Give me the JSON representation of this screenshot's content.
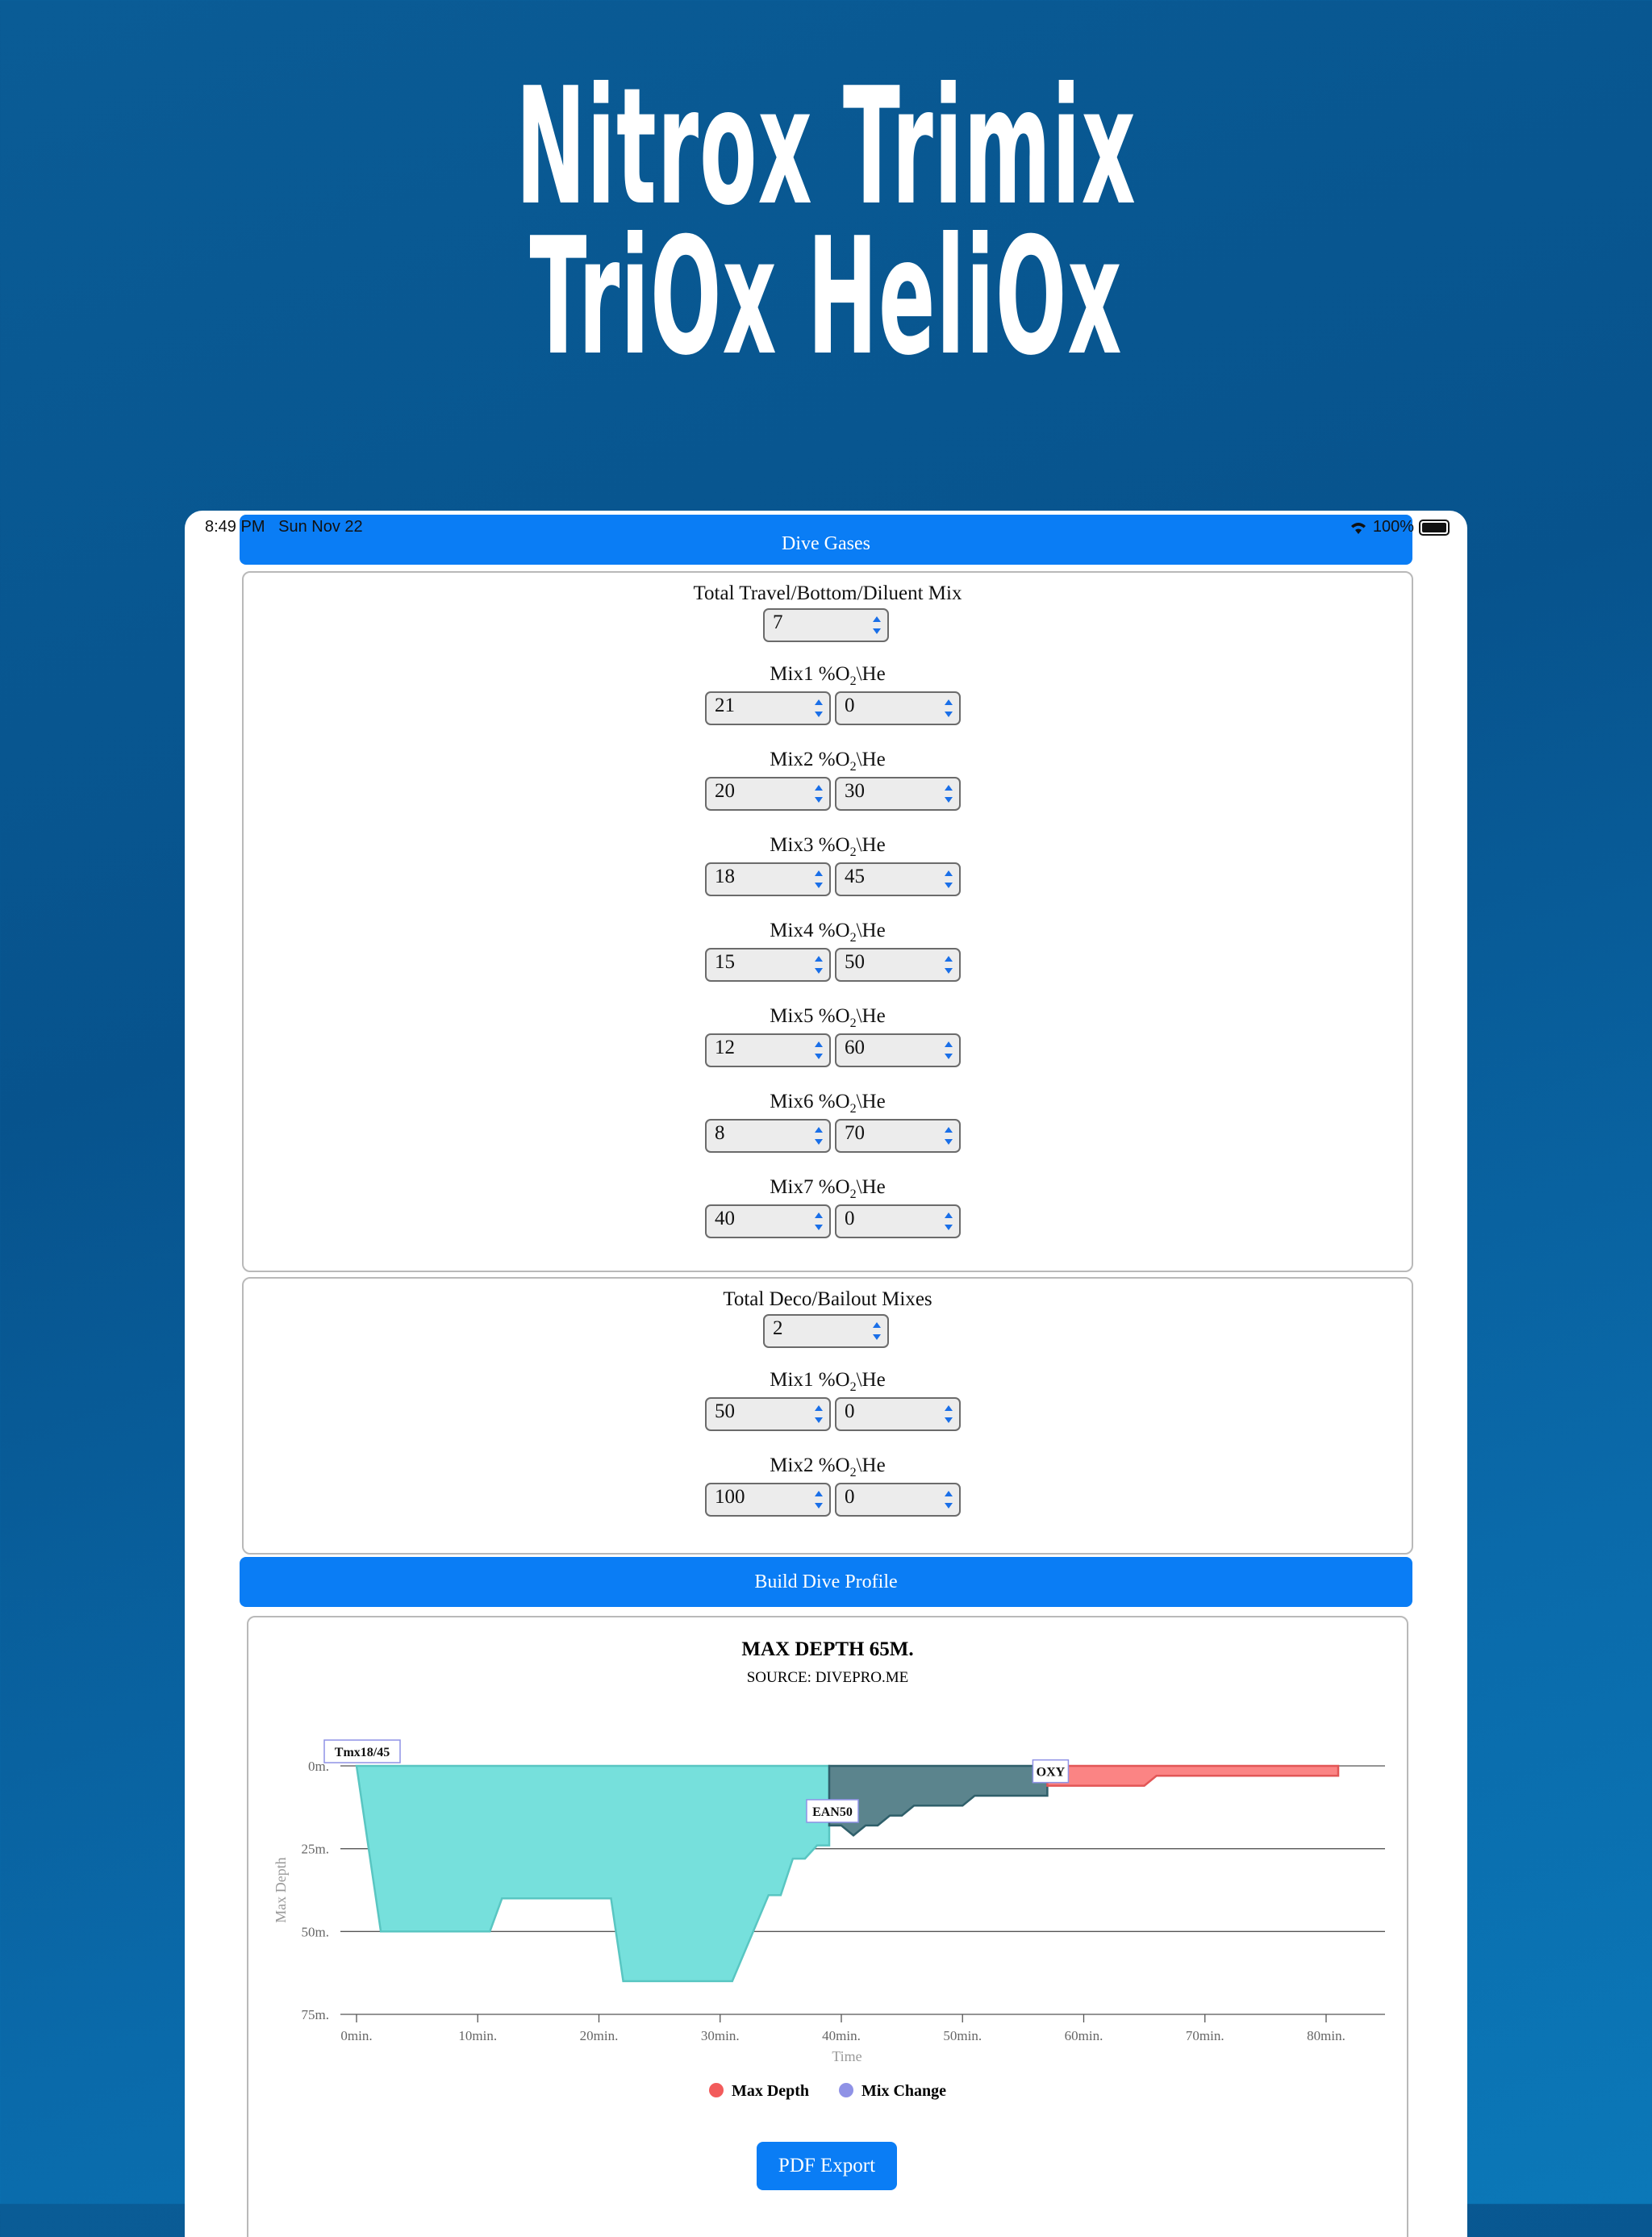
{
  "hero": {
    "line1": "Nitrox Trimix",
    "line2": "TriOx HeliOx"
  },
  "status_bar": {
    "time": "8:49 PM",
    "date": "Sun Nov 22",
    "battery": "100%",
    "wifi_icon": "wifi-icon",
    "battery_icon": "battery-icon"
  },
  "dive_gases_header": "Dive Gases",
  "travel": {
    "total_label": "Total Travel/Bottom/Diluent Mix",
    "total_value": "7",
    "mixes": [
      {
        "label": "Mix1 %O",
        "o2": "21",
        "he": "0"
      },
      {
        "label": "Mix2 %O",
        "o2": "20",
        "he": "30"
      },
      {
        "label": "Mix3 %O",
        "o2": "18",
        "he": "45"
      },
      {
        "label": "Mix4 %O",
        "o2": "15",
        "he": "50"
      },
      {
        "label": "Mix5 %O",
        "o2": "12",
        "he": "60"
      },
      {
        "label": "Mix6 %O",
        "o2": "8",
        "he": "70"
      },
      {
        "label": "Mix7 %O",
        "o2": "40",
        "he": "0"
      }
    ]
  },
  "deco": {
    "total_label": "Total Deco/Bailout Mixes",
    "total_value": "2",
    "mixes": [
      {
        "label": "Mix1 %O",
        "o2": "50",
        "he": "0"
      },
      {
        "label": "Mix2 %O",
        "o2": "100",
        "he": "0"
      }
    ]
  },
  "o2_subscript": "2",
  "he_suffix": "\\He",
  "build_button": "Build Dive Profile",
  "pdf_button": "PDF Export",
  "chart_data": {
    "type": "area",
    "title": "MAX DEPTH 65M.",
    "subtitle": "SOURCE: DIVEPRO.ME",
    "xlabel": "Time",
    "ylabel": "Max Depth",
    "xlim": [
      0,
      80
    ],
    "ylim": [
      0,
      75
    ],
    "x_ticks": [
      "0min.",
      "10min.",
      "20min.",
      "30min.",
      "40min.",
      "50min.",
      "60min.",
      "70min.",
      "80min."
    ],
    "y_ticks": [
      "0m.",
      "25m.",
      "50m.",
      "75m."
    ],
    "legend": [
      "Max Depth",
      "Mix Change"
    ],
    "legend_placement": "bottom",
    "colors": {
      "Tmx18/45": "#76e0dc",
      "EAN50": "#5b848d",
      "OXY": "#fb8484",
      "Max Depth": "#f25b5b",
      "Mix Change": "#8f92e6"
    },
    "series": [
      {
        "name": "Tmx18/45",
        "points": [
          [
            0,
            0
          ],
          [
            2,
            50
          ],
          [
            11,
            50
          ],
          [
            12,
            40
          ],
          [
            21,
            40
          ],
          [
            22,
            65
          ],
          [
            31,
            65
          ],
          [
            34,
            39
          ],
          [
            35,
            39
          ],
          [
            36,
            28
          ],
          [
            37,
            28
          ],
          [
            38,
            24
          ],
          [
            39,
            24
          ],
          [
            39,
            0
          ]
        ]
      },
      {
        "name": "EAN50",
        "points": [
          [
            39,
            0
          ],
          [
            39,
            18
          ],
          [
            40,
            18
          ],
          [
            41,
            21
          ],
          [
            42,
            18
          ],
          [
            43,
            18
          ],
          [
            44,
            15
          ],
          [
            45,
            15
          ],
          [
            46,
            12
          ],
          [
            50,
            12
          ],
          [
            51,
            9
          ],
          [
            57,
            9
          ],
          [
            57,
            0
          ]
        ]
      },
      {
        "name": "OXY",
        "points": [
          [
            57,
            0
          ],
          [
            57,
            6
          ],
          [
            65,
            6
          ],
          [
            66,
            3
          ],
          [
            81,
            3
          ],
          [
            81,
            0
          ]
        ]
      }
    ],
    "annotations": [
      {
        "label": "Tmx18/45",
        "x": 0,
        "y": 0
      },
      {
        "label": "EAN50",
        "x": 39,
        "y": 18
      },
      {
        "label": "OXY",
        "x": 57,
        "y": 6
      }
    ]
  }
}
